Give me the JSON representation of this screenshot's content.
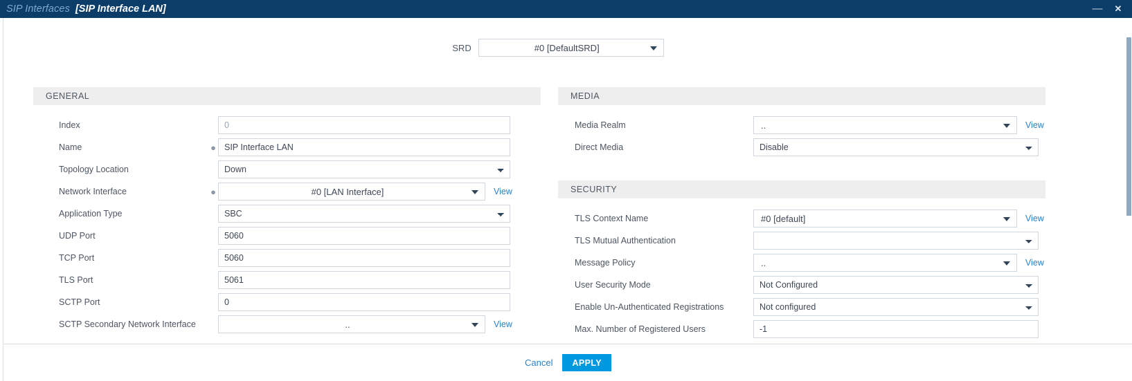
{
  "titlebar": {
    "breadcrumb": "SIP Interfaces",
    "page": "[SIP Interface LAN]",
    "minimize_icon": "minimize-icon",
    "minimize_glyph": "—",
    "close_icon": "close-icon",
    "close_glyph": "✕"
  },
  "srd": {
    "label": "SRD",
    "value": "#0 [DefaultSRD]"
  },
  "general": {
    "title": "GENERAL",
    "rows": [
      {
        "label": "Index",
        "value": "0",
        "type": "text-disabled",
        "required": false,
        "view": false
      },
      {
        "label": "Name",
        "value": "SIP Interface LAN",
        "type": "text",
        "required": true,
        "view": false
      },
      {
        "label": "Topology Location",
        "value": "Down",
        "type": "select",
        "required": false,
        "view": false
      },
      {
        "label": "Network Interface",
        "value": "#0 [LAN Interface]",
        "type": "select-fancy",
        "required": true,
        "view": true
      },
      {
        "label": "Application Type",
        "value": "SBC",
        "type": "select",
        "required": false,
        "view": false
      },
      {
        "label": "UDP Port",
        "value": "5060",
        "type": "text",
        "required": false,
        "view": false
      },
      {
        "label": "TCP Port",
        "value": "5060",
        "type": "text",
        "required": false,
        "view": false
      },
      {
        "label": "TLS Port",
        "value": "5061",
        "type": "text",
        "required": false,
        "view": false
      },
      {
        "label": "SCTP Port",
        "value": "0",
        "type": "text",
        "required": false,
        "view": false
      },
      {
        "label": "SCTP Secondary Network Interface",
        "value": "..",
        "type": "select-fancy",
        "required": false,
        "view": true
      }
    ]
  },
  "media": {
    "title": "MEDIA",
    "rows": [
      {
        "label": "Media Realm",
        "value": "..",
        "type": "select-fancy",
        "required": false,
        "view": true
      },
      {
        "label": "Direct Media",
        "value": "Disable",
        "type": "select",
        "required": false,
        "view": false
      }
    ]
  },
  "security": {
    "title": "SECURITY",
    "rows": [
      {
        "label": "TLS Context Name",
        "value": "#0 [default]",
        "type": "select-fancy",
        "required": false,
        "view": true
      },
      {
        "label": "TLS Mutual Authentication",
        "value": "",
        "type": "select",
        "required": false,
        "view": false
      },
      {
        "label": "Message Policy",
        "value": "..",
        "type": "select-fancy",
        "required": false,
        "view": true
      },
      {
        "label": "User Security Mode",
        "value": "Not Configured",
        "type": "select",
        "required": false,
        "view": false
      },
      {
        "label": "Enable Un-Authenticated Registrations",
        "value": "Not configured",
        "type": "select",
        "required": false,
        "view": false
      },
      {
        "label": "Max. Number of Registered Users",
        "value": "-1",
        "type": "text",
        "required": false,
        "view": false
      }
    ]
  },
  "footer": {
    "cancel_label": "Cancel",
    "apply_label": "APPLY"
  },
  "view_link_label": "View",
  "colors": {
    "titlebar_bg": "#0c3c68",
    "breadcrumb": "#7fa9d0",
    "accent_link": "#2b7fc3",
    "apply_bg": "#0099e0",
    "section_header_bg": "#eeeeee",
    "scrollbar_thumb": "#8fa9c2"
  }
}
